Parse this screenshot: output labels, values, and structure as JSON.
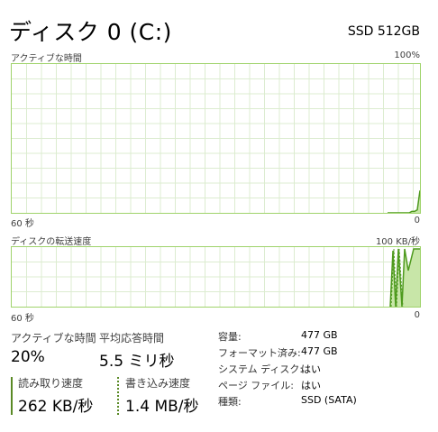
{
  "header": {
    "title": "ディスク 0 (C:)",
    "model": "SSD 512GB"
  },
  "active_time_graph": {
    "label": "アクティブな時間",
    "max_label": "100%",
    "time_label": "60 秒",
    "min_label": "0",
    "recent_percent": [
      0,
      0,
      0,
      0,
      0,
      0,
      0,
      0,
      0,
      1,
      1,
      2,
      15
    ]
  },
  "transfer_graph": {
    "label": "ディスクの転送速度",
    "max_label": "100 KB/秒",
    "time_label": "60 秒",
    "min_label": "0"
  },
  "stats": {
    "active_time": {
      "label": "アクティブな時間",
      "value": "20%"
    },
    "response_time": {
      "label": "平均応答時間",
      "value": "5.5 ミリ秒"
    },
    "read_speed": {
      "label": "読み取り速度",
      "value": "262 KB/秒"
    },
    "write_speed": {
      "label": "書き込み速度",
      "value": "1.4 MB/秒"
    }
  },
  "info": [
    {
      "label": "容量:",
      "value": "477 GB"
    },
    {
      "label": "フォーマット済み:",
      "value": "477 GB"
    },
    {
      "label": "システム ディスク:",
      "value": "はい"
    },
    {
      "label": "ページ ファイル:",
      "value": "はい"
    },
    {
      "label": "種類:",
      "value": "SSD (SATA)"
    }
  ],
  "colors": {
    "graph_border": "#9fd36b",
    "grid": "#dcecd0",
    "fill": "#c8e6a8",
    "line": "#4e9a1e"
  }
}
